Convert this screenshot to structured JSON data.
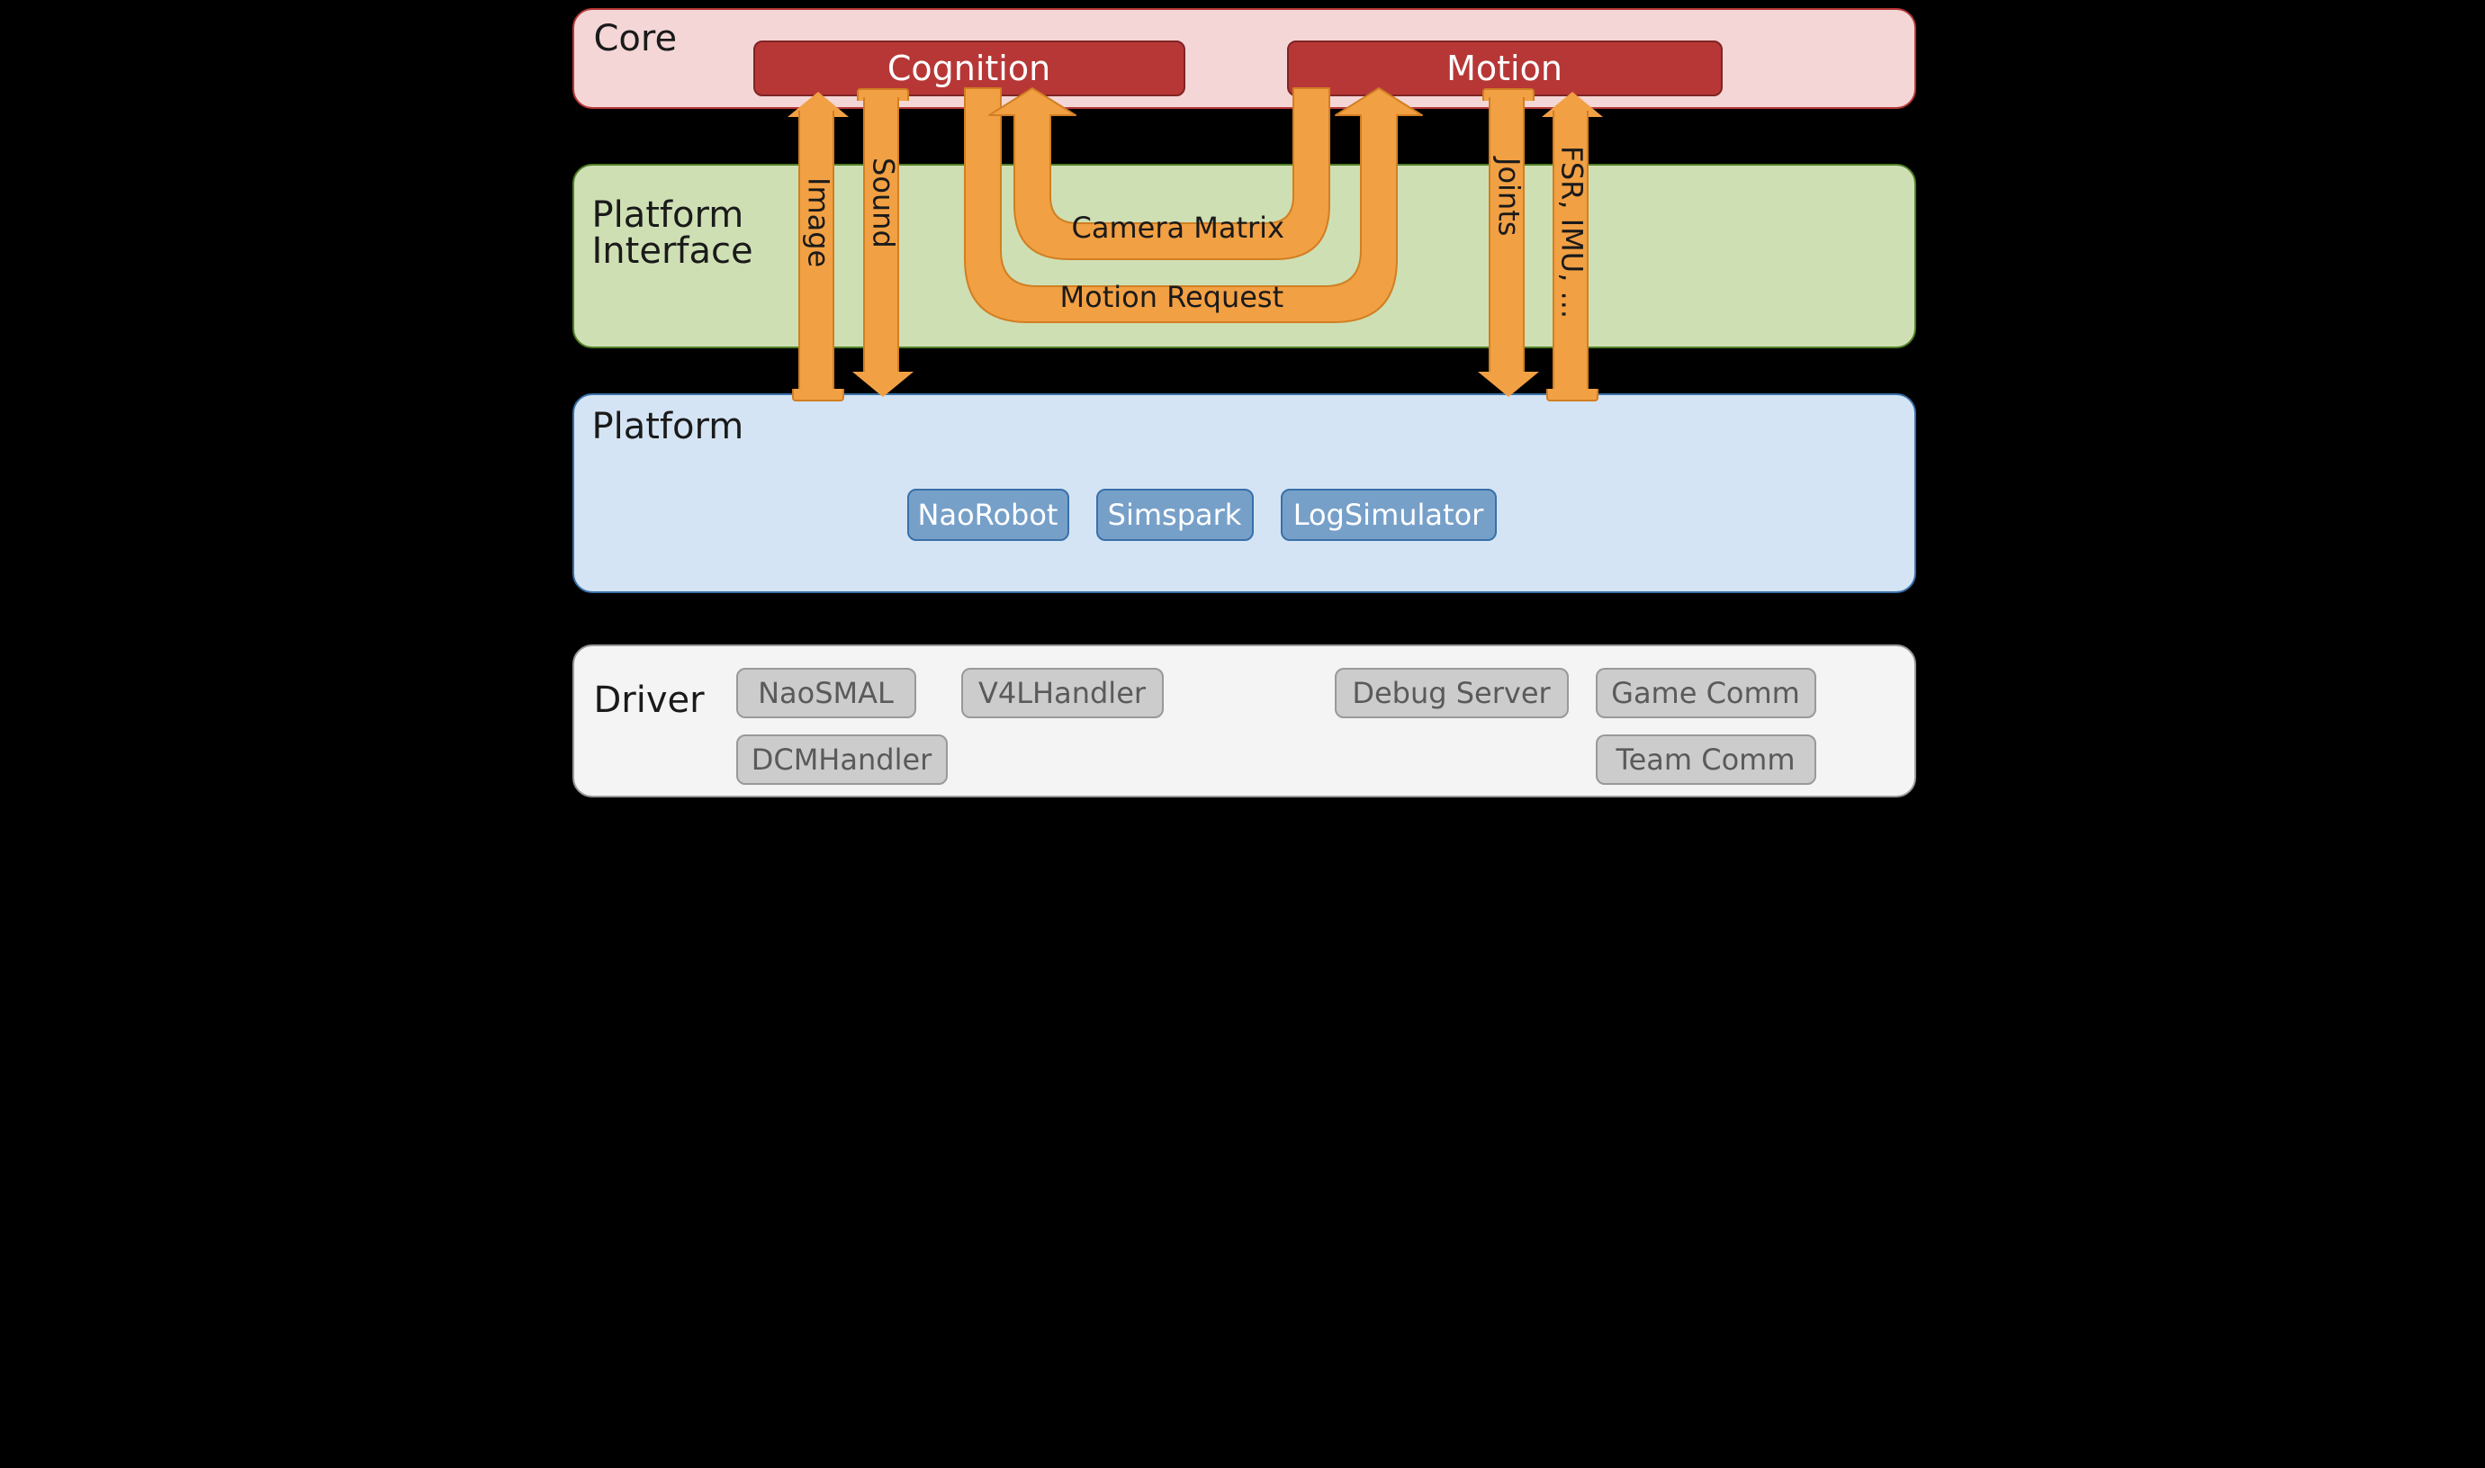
{
  "layers": {
    "core": {
      "title": "Core"
    },
    "platform_interface": {
      "title": "Platform\nInterface"
    },
    "platform": {
      "title": "Platform"
    },
    "driver": {
      "title": "Driver"
    }
  },
  "core_boxes": {
    "cognition": "Cognition",
    "motion": "Motion"
  },
  "platform_boxes": {
    "naorobot": "NaoRobot",
    "simspark": "Simspark",
    "logsimulator": "LogSimulator"
  },
  "driver_boxes": {
    "naosmal": "NaoSMAL",
    "v4lhandler": "V4LHandler",
    "debug_server": "Debug Server",
    "game_comm": "Game Comm",
    "dcmhandler": "DCMHandler",
    "team_comm": "Team Comm"
  },
  "arrows": {
    "image": {
      "label": "Image",
      "direction": "up",
      "from": "Platform",
      "to": "Cognition"
    },
    "sound": {
      "label": "Sound",
      "direction": "down",
      "from": "Cognition",
      "to": "Platform"
    },
    "camera_matrix": {
      "label": "Camera Matrix",
      "direction": "u-up",
      "from": "Motion",
      "to": "Cognition"
    },
    "motion_request": {
      "label": "Motion Request",
      "direction": "u-down",
      "from": "Cognition",
      "to": "Motion"
    },
    "joints": {
      "label": "Joints",
      "direction": "down",
      "from": "Motion",
      "to": "Platform"
    },
    "fsr_imu": {
      "label": "FSR, IMU, ...",
      "direction": "up",
      "from": "Platform",
      "to": "Motion"
    }
  },
  "colors": {
    "core_bg": "#f4d6d6",
    "core_border": "#b73737",
    "pi_bg": "#cfdfb4",
    "pi_border": "#4f7f27",
    "platform_bg": "#d4e4f4",
    "platform_border": "#3970a8",
    "driver_bg": "#f4f4f4",
    "driver_border": "#999999",
    "arrow_fill": "#f2a044",
    "arrow_border": "#d17f22",
    "core_box_bg": "#b73737",
    "core_box_border": "#7f2424",
    "plat_box_bg": "#77a0c9",
    "plat_box_border": "#3970a8",
    "drv_box_bg": "#cccccc",
    "drv_box_border": "#999999"
  }
}
